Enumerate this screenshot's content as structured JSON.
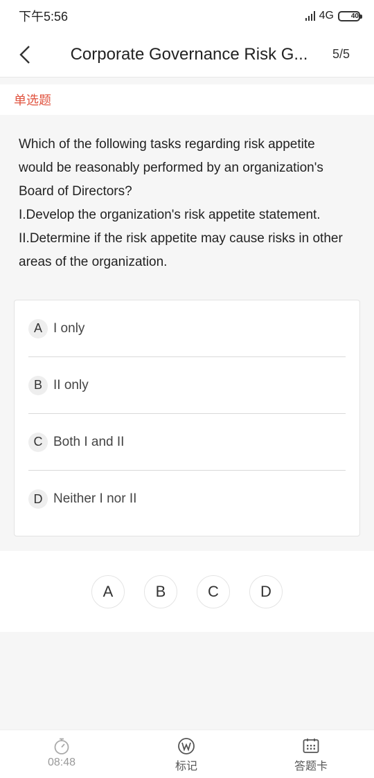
{
  "status_bar": {
    "time": "下午5:56",
    "network": "4G",
    "battery": "40"
  },
  "nav": {
    "title": "Corporate Governance Risk G...",
    "count": "5/5"
  },
  "question": {
    "type": "单选题",
    "text": "Which of the following tasks regarding risk appetite would be reasonably performed by an organization's Board of Directors?\n I.Develop the organization's risk appetite statement.\nII.Determine if the risk appetite may cause risks in other areas of the organization.",
    "options": [
      {
        "letter": "A",
        "text": "I only"
      },
      {
        "letter": "B",
        "text": "II only"
      },
      {
        "letter": "C",
        "text": "Both I and II"
      },
      {
        "letter": "D",
        "text": "Neither I nor II"
      }
    ]
  },
  "choices": [
    "A",
    "B",
    "C",
    "D"
  ],
  "bottom_bar": {
    "timer": "08:48",
    "mark_label": "标记",
    "answer_card_label": "答题卡"
  },
  "colors": {
    "accent": "#e0533f",
    "battery": "#f3c200"
  }
}
